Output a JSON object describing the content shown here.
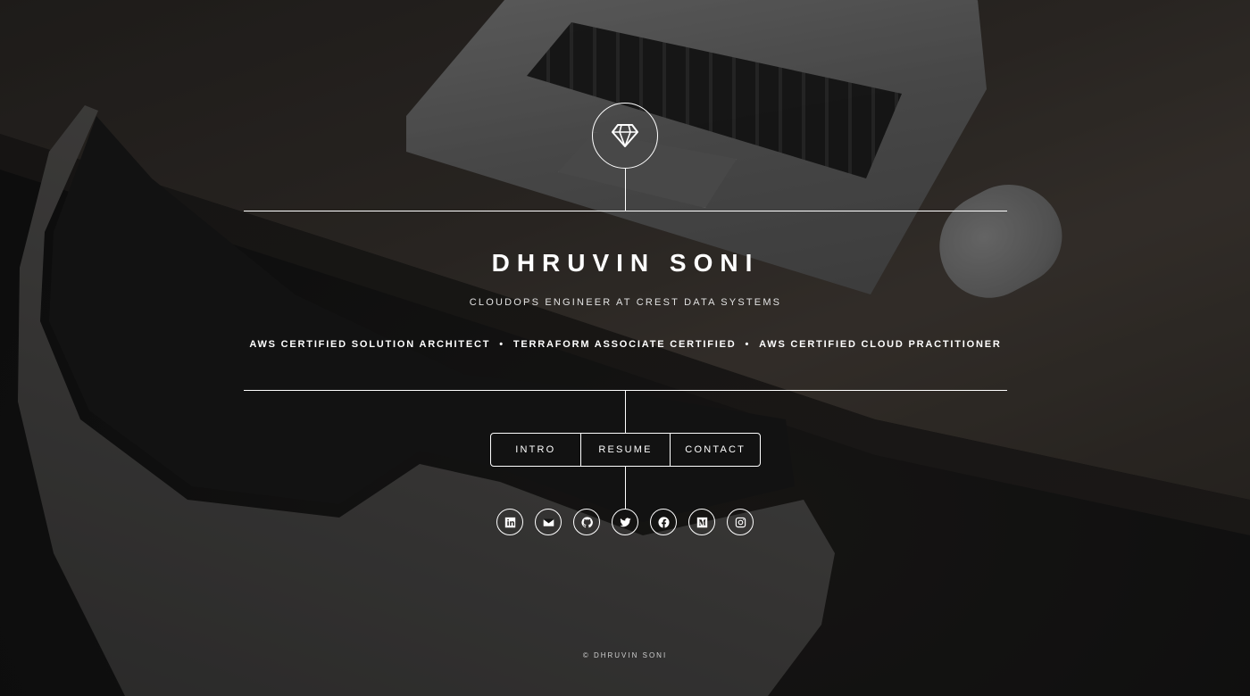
{
  "header": {
    "logo_icon": "diamond-icon",
    "name": "DHRUVIN SONI",
    "subtitle": "CLOUDOPS ENGINEER AT CREST DATA SYSTEMS",
    "certifications": [
      "AWS CERTIFIED SOLUTION ARCHITECT",
      "TERRAFORM ASSOCIATE CERTIFIED",
      "AWS CERTIFIED CLOUD PRACTITIONER"
    ],
    "separator": "•"
  },
  "nav": {
    "items": [
      {
        "label": "INTRO"
      },
      {
        "label": "RESUME"
      },
      {
        "label": "CONTACT"
      }
    ]
  },
  "socials": [
    {
      "icon": "linkedin-icon"
    },
    {
      "icon": "email-icon"
    },
    {
      "icon": "github-icon"
    },
    {
      "icon": "twitter-icon"
    },
    {
      "icon": "facebook-icon"
    },
    {
      "icon": "medium-icon"
    },
    {
      "icon": "instagram-icon"
    }
  ],
  "footer": {
    "copyright": "© DHRUVIN SONI"
  },
  "colors": {
    "foreground": "#ffffff",
    "background": "#141414"
  }
}
